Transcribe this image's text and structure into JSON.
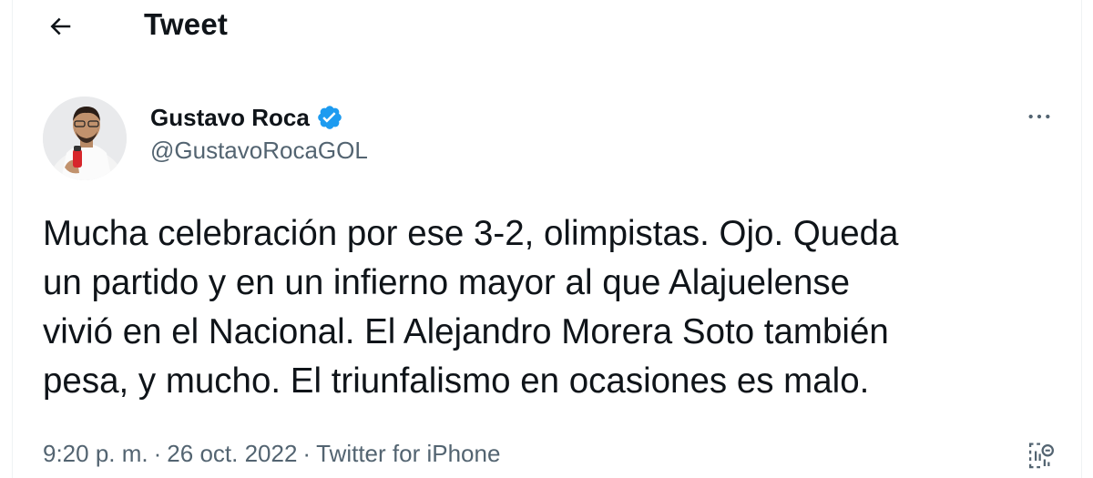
{
  "header": {
    "title": "Tweet",
    "back_icon": "arrow-left-icon"
  },
  "author": {
    "display_name": "Gustavo Roca",
    "handle": "@GustavoRocaGOL",
    "verified": true,
    "verified_color": "#1d9bf0"
  },
  "tweet": {
    "lines": [
      "Mucha celebración por ese 3-2, olimpistas. Ojo. Queda",
      "un partido y en un infierno mayor al que Alajuelense",
      "vivió en el Nacional. El Alejandro Morera Soto también",
      "pesa, y mucho. El triunfalismo en ocasiones es malo."
    ],
    "time": "9:20 p. m.",
    "separator": "·",
    "date": "26 oct. 2022",
    "source": "Twitter for iPhone"
  },
  "icons": {
    "more": "more-horizontal-icon",
    "analytics": "analytics-icon"
  },
  "colors": {
    "text_primary": "#0f1419",
    "text_secondary": "#536471",
    "accent": "#1d9bf0"
  }
}
